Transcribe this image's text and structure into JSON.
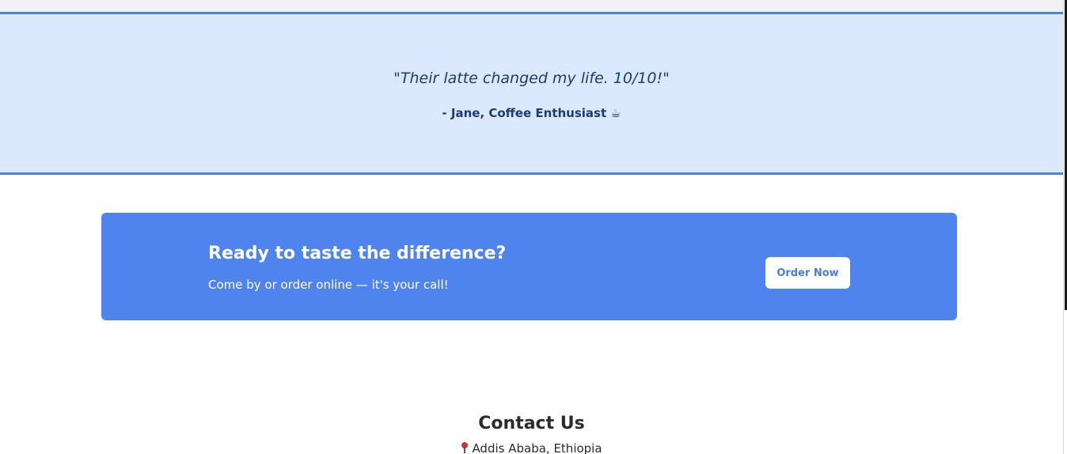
{
  "testimonial": {
    "quote": "\"Their latte changed my life. 10/10!\"",
    "author": "- Jane, Coffee Enthusiast",
    "author_icon": "coffee-cup-icon"
  },
  "cta": {
    "title": "Ready to taste the difference?",
    "subtitle": "Come by or order online — it's your call!",
    "button_label": "Order Now"
  },
  "contact": {
    "title": "Contact Us",
    "address": "Addis Ababa, Ethiopia",
    "address_icon": "map-pin-icon"
  },
  "colors": {
    "testimonial_bg": "#dbe9fe",
    "testimonial_border": "#4a84dc",
    "testimonial_text": "#1f3b73",
    "cta_bg": "#4f84ee",
    "button_text": "#4a7dd8"
  }
}
